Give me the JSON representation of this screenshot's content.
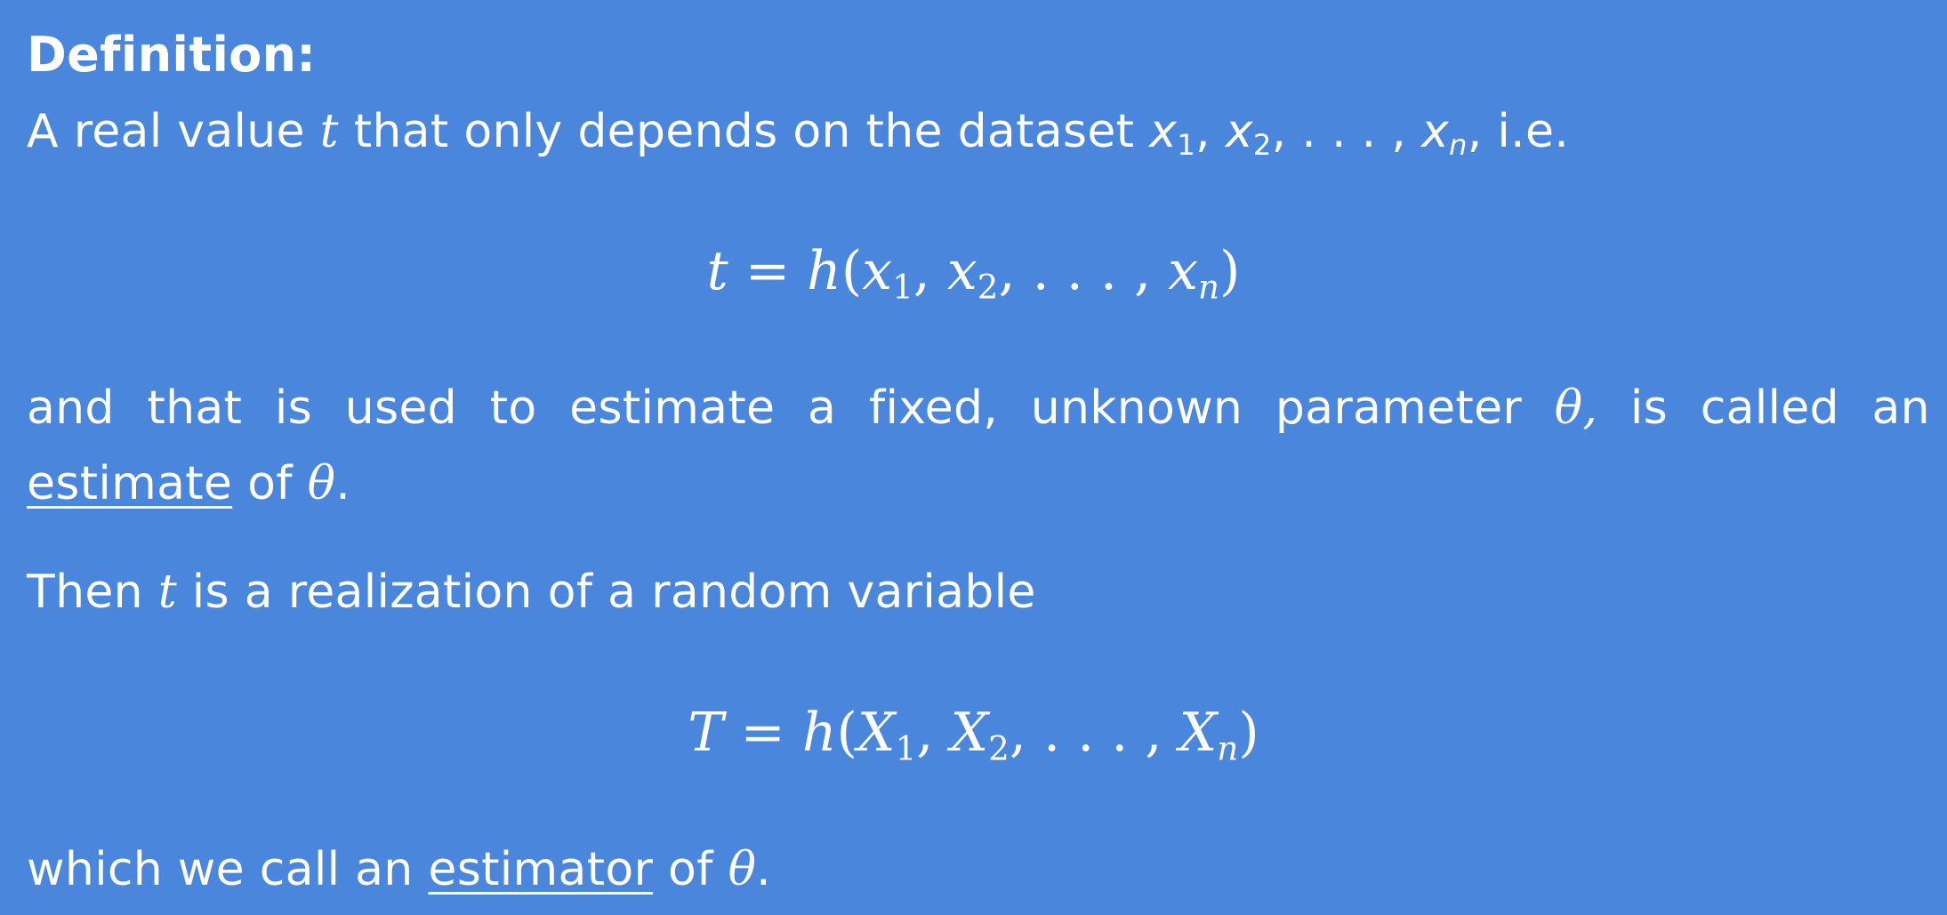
{
  "definition": {
    "heading": "Definition:",
    "line1": {
      "pre": "A real value",
      "t": "t",
      "mid": "that only depends on the dataset",
      "x": "x",
      "sub1": "1",
      "sep1": ",",
      "sub2": "2",
      "dots": ", . . . ,",
      "subn": "n",
      "post": ", i.e."
    },
    "eq1": {
      "lhs": "t",
      "eq": "=",
      "fn": "h",
      "open": "(",
      "x": "x",
      "sub1": "1",
      "sep": ",",
      "sub2": "2",
      "dots": ", . . . ,",
      "subn": "n",
      "close": ")"
    },
    "line2": {
      "words": [
        "and",
        "that",
        "is",
        "used",
        "to",
        "estimate",
        "a",
        "fixed,",
        "unknown",
        "parameter",
        "θ,",
        "is",
        "called",
        "an"
      ]
    },
    "line3": {
      "term": "estimate",
      "post": "of",
      "theta": "θ",
      "end": "."
    },
    "line4": {
      "pre": "Then",
      "t": "t",
      "post": "is a realization of a random variable"
    },
    "eq2": {
      "lhs": "T",
      "eq": "=",
      "fn": "h",
      "open": "(",
      "x": "X",
      "sub1": "1",
      "sep": ",",
      "sub2": "2",
      "dots": ", . . . ,",
      "subn": "n",
      "close": ")"
    },
    "line5": {
      "pre": "which we call an",
      "term": "estimator",
      "post": "of",
      "theta": "θ",
      "end": "."
    }
  },
  "colors": {
    "background": "#4a86dc",
    "text": "#ffffff"
  }
}
